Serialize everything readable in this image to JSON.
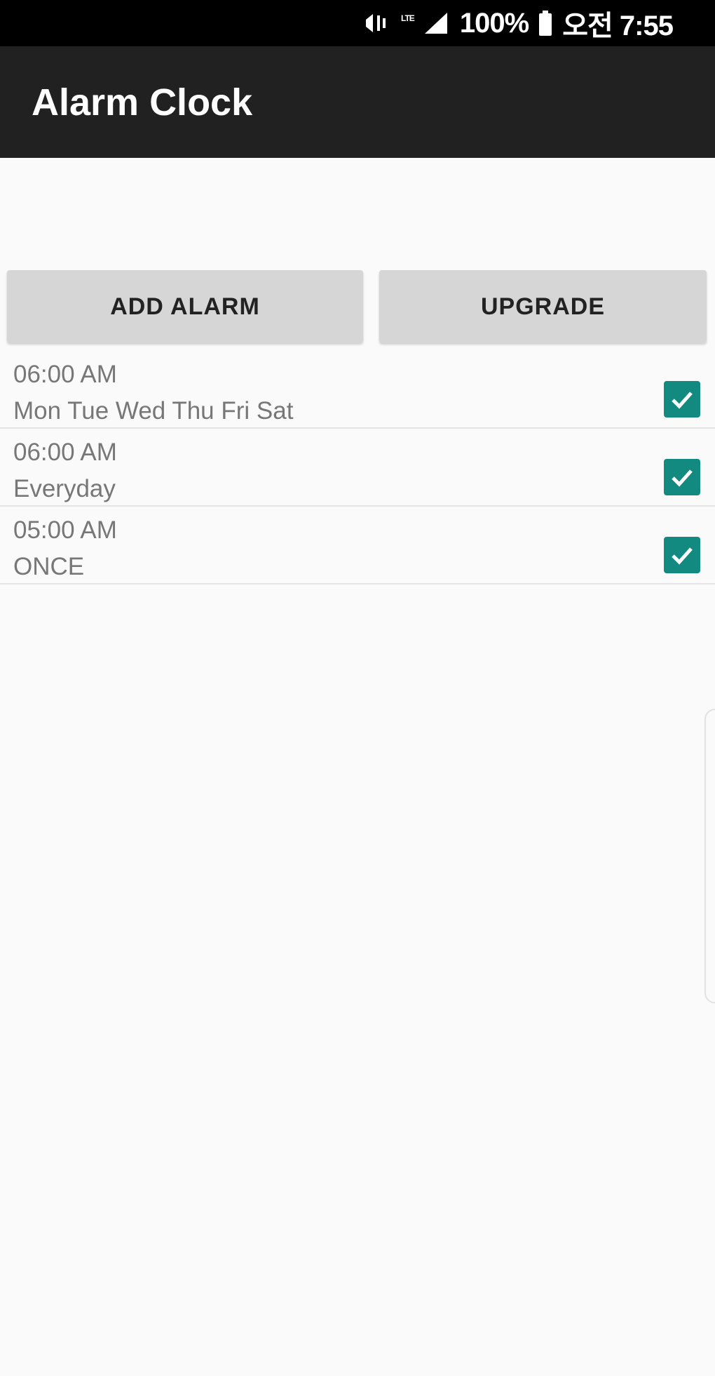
{
  "status_bar": {
    "network_icon": "signal-icon",
    "battery_text": "100%",
    "battery_icon": "battery-icon",
    "time_text": "오전 7:55"
  },
  "toolbar": {
    "title": "Alarm Clock"
  },
  "buttons": {
    "add_alarm": "ADD ALARM",
    "upgrade": "UPGRADE"
  },
  "alarms": [
    {
      "time": "06:00 AM",
      "days": "Mon Tue Wed Thu Fri Sat",
      "enabled": true
    },
    {
      "time": "06:00 AM",
      "days": "Everyday",
      "enabled": true
    },
    {
      "time": "05:00 AM",
      "days": "ONCE",
      "enabled": true
    }
  ],
  "colors": {
    "toolbar_bg": "#212121",
    "checkbox": "#138a80",
    "background": "#fafafa"
  }
}
